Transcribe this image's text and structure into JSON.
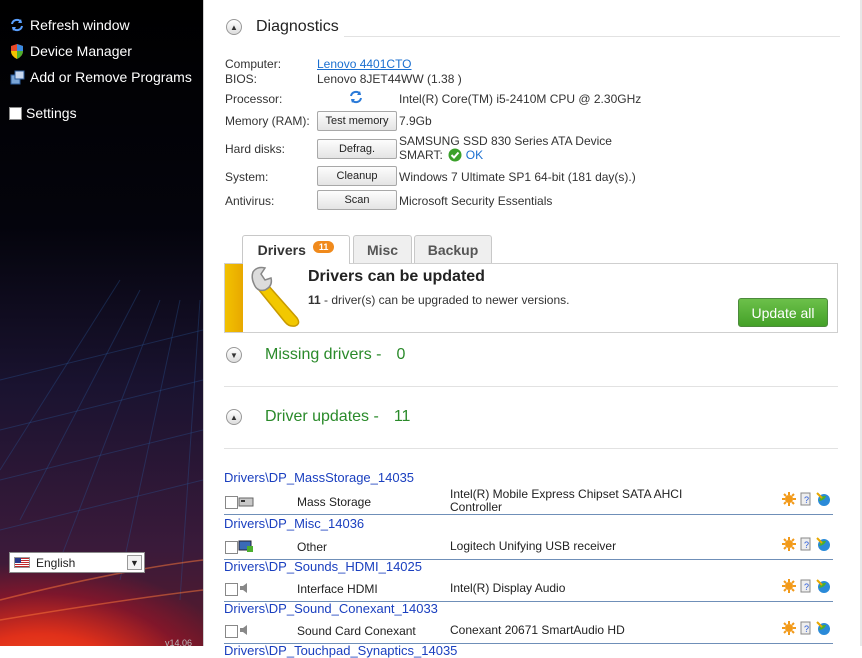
{
  "sidebar": {
    "items": [
      {
        "label": "Refresh window",
        "icon": "refresh-icon"
      },
      {
        "label": "Device Manager",
        "icon": "shield-icon"
      },
      {
        "label": "Add or Remove Programs",
        "icon": "programs-icon"
      }
    ],
    "settings_label": "Settings",
    "language": {
      "selected": "English",
      "icon": "us-flag-icon"
    },
    "version": "v14.06"
  },
  "diagnostics": {
    "title": "Diagnostics",
    "computer": {
      "label": "Computer:",
      "value": "Lenovo 4401CTO"
    },
    "bios": {
      "label": "BIOS:",
      "value": "Lenovo 8JET44WW (1.38 )"
    },
    "processor": {
      "label": "Processor:",
      "value": "Intel(R) Core(TM) i5-2410M CPU @ 2.30GHz"
    },
    "memory": {
      "label": "Memory (RAM):",
      "button": "Test memory",
      "value": "7.9Gb"
    },
    "hard_disks": {
      "label": "Hard disks:",
      "button": "Defrag.",
      "value": "SAMSUNG SSD 830 Series ATA Device",
      "smart_label": "SMART:",
      "smart_status": "OK"
    },
    "system": {
      "label": "System:",
      "button": "Cleanup",
      "value": "Windows 7 Ultimate SP1 64-bit (181 day(s).)"
    },
    "antivirus": {
      "label": "Antivirus:",
      "button": "Scan",
      "value": "Microsoft Security Essentials"
    }
  },
  "tabs": [
    {
      "label": "Drivers",
      "badge": "11",
      "active": true
    },
    {
      "label": "Misc"
    },
    {
      "label": "Backup"
    }
  ],
  "drivers_panel": {
    "title": "Drivers can be updated",
    "count": "11",
    "message": " - driver(s) can be upgraded to newer versions.",
    "button": "Update all"
  },
  "missing_drivers": {
    "label": "Missing drivers  -",
    "count": "0"
  },
  "driver_updates": {
    "label": "Driver updates  -",
    "count": "11"
  },
  "driver_list": [
    {
      "path": "Drivers\\DP_MassStorage_14035",
      "name": "Mass Storage",
      "desc1": "Intel(R) Mobile Express Chipset SATA AHCI",
      "desc2": "Controller"
    },
    {
      "path": "Drivers\\DP_Misc_14036",
      "name": "Other",
      "desc1": "Logitech Unifying USB receiver",
      "desc2": ""
    },
    {
      "path": "Drivers\\DP_Sounds_HDMI_14025",
      "name": "Interface HDMI",
      "desc1": "Intel(R) Display Audio",
      "desc2": ""
    },
    {
      "path": "Drivers\\DP_Sound_Conexant_14033",
      "name": "Sound Card Conexant",
      "desc1": "Conexant 20671 SmartAudio HD",
      "desc2": ""
    },
    {
      "path": "Drivers\\DP_Touchpad_Synaptics_14035",
      "name": "",
      "desc1": "",
      "desc2": ""
    }
  ],
  "colors": {
    "accent_green": "#2a8a2a",
    "link_blue": "#1a6fd0",
    "badge_orange": "#f08a1c",
    "update_button": "#4caf2e"
  }
}
